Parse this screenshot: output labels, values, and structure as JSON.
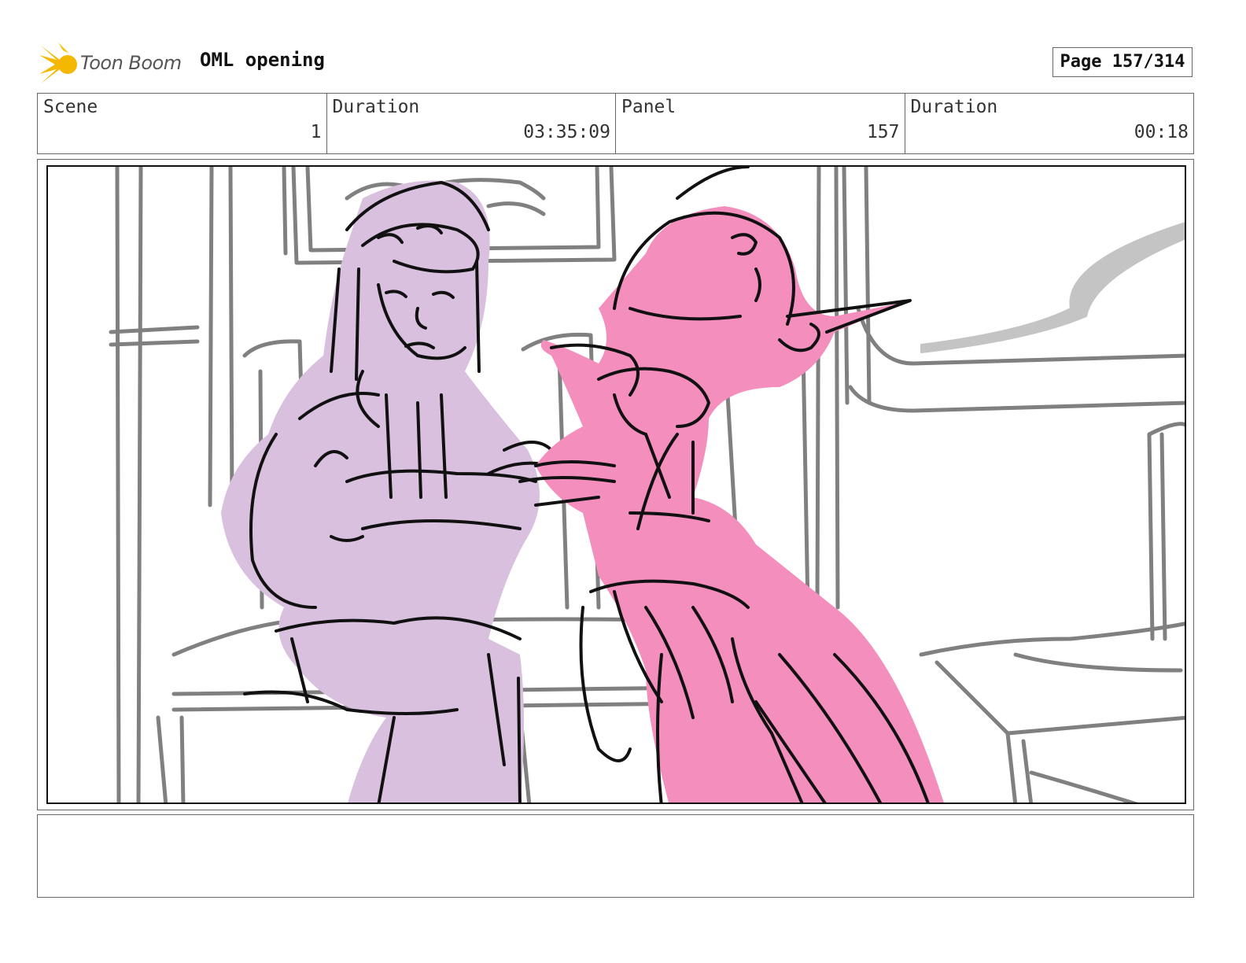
{
  "header": {
    "logo_text": "Toon Boom",
    "project_title": "OML opening",
    "page_label": "Page 157/314"
  },
  "info": {
    "scene_label": "Scene",
    "scene_value": "1",
    "scene_duration_label": "Duration",
    "scene_duration_value": "03:35:09",
    "panel_label": "Panel",
    "panel_value": "157",
    "panel_duration_label": "Duration",
    "panel_duration_value": "00:18"
  },
  "colors": {
    "logo_star": "#f5b800",
    "character_left": "#d8c0de",
    "character_right": "#f48fbd",
    "background_sketch": "#808080",
    "ink": "#111111"
  },
  "notes": {
    "text": ""
  }
}
